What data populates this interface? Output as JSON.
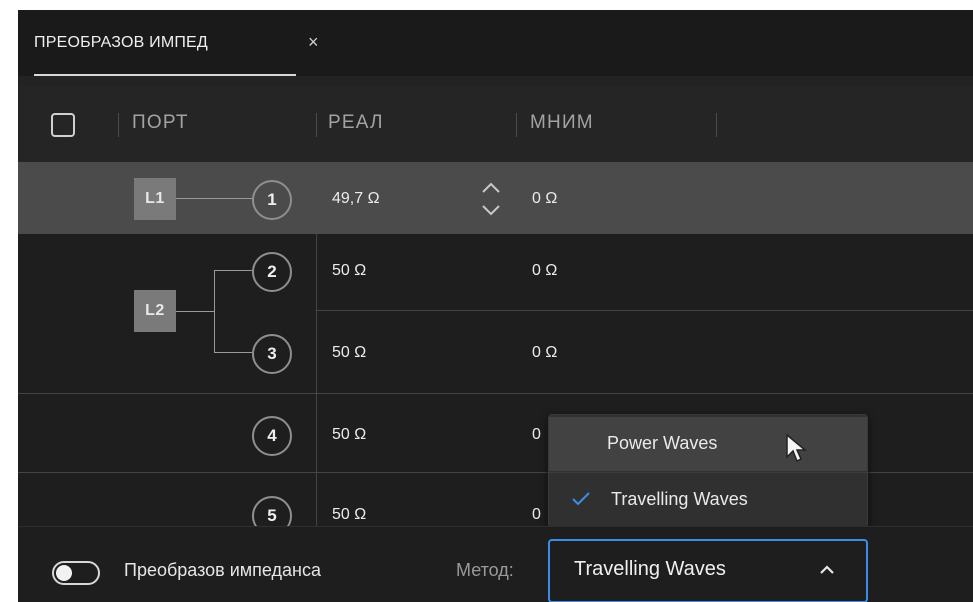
{
  "tab": {
    "title": "ПРЕОБРАЗОВ ИМПЕД",
    "close_glyph": "×"
  },
  "table": {
    "headers": [
      "ПОРТ",
      "РЕАЛ",
      "МНИМ"
    ],
    "groups": [
      {
        "label": "L1",
        "selected": true
      },
      {
        "label": "L2",
        "selected": false
      }
    ],
    "rows": [
      {
        "port": "1",
        "real": "49,7 Ω",
        "imag": "0 Ω"
      },
      {
        "port": "2",
        "real": "50 Ω",
        "imag": "0 Ω"
      },
      {
        "port": "3",
        "real": "50 Ω",
        "imag": "0 Ω"
      },
      {
        "port": "4",
        "real": "50 Ω",
        "imag": "0"
      },
      {
        "port": "5",
        "real": "50 Ω",
        "imag": "0"
      }
    ]
  },
  "dropdown": {
    "options": [
      {
        "label": "Power Waves",
        "checked": false,
        "hovered": true
      },
      {
        "label": "Travelling Waves",
        "checked": true,
        "hovered": false
      }
    ]
  },
  "footer": {
    "toggle_label": "Преобразов импеданса",
    "toggle_on": false,
    "method_label": "Метод:",
    "method_value": "Travelling Waves"
  },
  "colors": {
    "accent": "#3a8ee6",
    "selected_row": "#4b4b4b",
    "panel": "#1e1e1e"
  },
  "icons": [
    "close-icon",
    "spin-up-icon",
    "spin-down-icon",
    "checkmark-icon",
    "chevron-up-icon",
    "mouse-pointer-icon"
  ]
}
